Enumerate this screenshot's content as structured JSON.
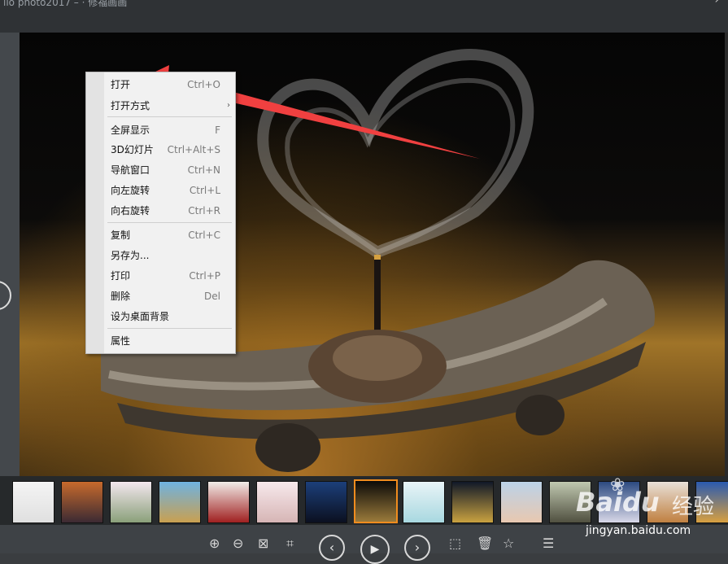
{
  "window": {
    "title": "ilo  photo2017  –  ·  修福画画",
    "top_right": "›   ·"
  },
  "context_menu": {
    "items": [
      {
        "label": "打开",
        "shortcut": "Ctrl+O"
      },
      {
        "label": "打开方式",
        "shortcut": "",
        "submenu": true
      },
      {
        "label": "全屏显示",
        "shortcut": "F"
      },
      {
        "label": "3D幻灯片",
        "shortcut": "Ctrl+Alt+S"
      },
      {
        "label": "导航窗口",
        "shortcut": "Ctrl+N"
      },
      {
        "label": "向左旋转",
        "shortcut": "Ctrl+L"
      },
      {
        "label": "向右旋转",
        "shortcut": "Ctrl+R"
      },
      {
        "label": "复制",
        "shortcut": "Ctrl+C"
      },
      {
        "label": "另存为...",
        "shortcut": ""
      },
      {
        "label": "打印",
        "shortcut": "Ctrl+P"
      },
      {
        "label": "删除",
        "shortcut": "Del"
      },
      {
        "label": "设为桌面背景",
        "shortcut": ""
      },
      {
        "label": "属性",
        "shortcut": ""
      }
    ],
    "submenu_arrow": "›"
  },
  "thumbnails": [
    {
      "colors": [
        "#f4f4f4",
        "#e0e0e0"
      ]
    },
    {
      "colors": [
        "#c76a2c",
        "#3b2a33"
      ]
    },
    {
      "colors": [
        "#f3e7ee",
        "#8aa07a"
      ]
    },
    {
      "colors": [
        "#6fb2e0",
        "#c9a050"
      ]
    },
    {
      "colors": [
        "#f1ece8",
        "#a02020"
      ]
    },
    {
      "colors": [
        "#f7e9ec",
        "#d6b5b5"
      ]
    },
    {
      "colors": [
        "#1c3f7a",
        "#0b1020"
      ]
    },
    {
      "colors": [
        "#0b0a08",
        "#9a7a3a"
      ],
      "selected": true
    },
    {
      "colors": [
        "#e9f4f7",
        "#a8d8e0"
      ]
    },
    {
      "colors": [
        "#101828",
        "#c9a240"
      ]
    },
    {
      "colors": [
        "#bcd2e8",
        "#e8c8b0"
      ]
    },
    {
      "colors": [
        "#c0c8b0",
        "#505040"
      ]
    },
    {
      "colors": [
        "#2c4a80",
        "#d8d8e8"
      ]
    },
    {
      "colors": [
        "#e8e0d8",
        "#c08040"
      ]
    },
    {
      "colors": [
        "#2a5ab0",
        "#d8a040"
      ]
    }
  ],
  "toolbar": {
    "zoom_in": "⊕",
    "zoom_out": "⊖",
    "fit": "⊠",
    "actual": "⌗",
    "prev": "‹",
    "play": "▶",
    "next": "›",
    "crop": "⬚",
    "delete": "🗑",
    "star": "☆",
    "menu": "☰"
  },
  "watermark": {
    "brand": "Baidu",
    "cn": "经验",
    "url": "jingyan.baidu.com",
    "paw": "❀"
  }
}
